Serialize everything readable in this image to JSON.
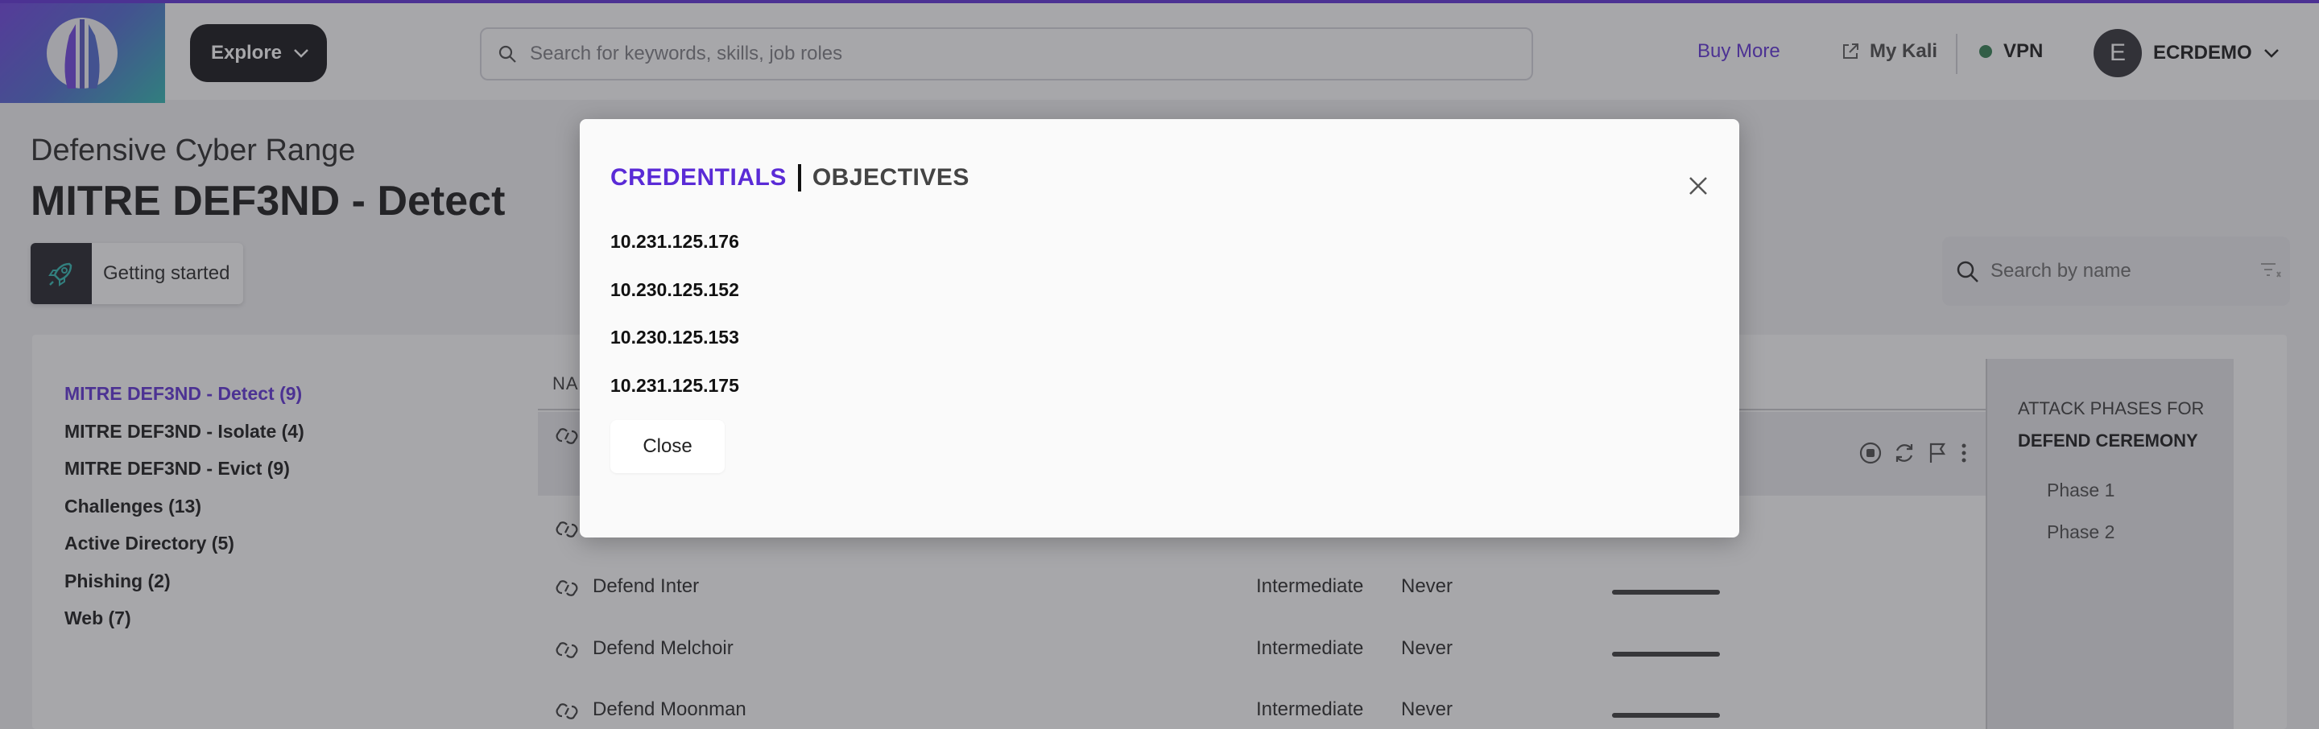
{
  "topbar": {
    "explore_label": "Explore",
    "search_placeholder": "Search for keywords, skills, job roles",
    "buy_more": "Buy More",
    "my_kali": "My Kali",
    "vpn": "VPN",
    "vpn_status_color": "#2b7a4b",
    "avatar_initial": "E",
    "username": "ECRDEMO"
  },
  "header": {
    "category": "Defensive Cyber Range",
    "title": "MITRE DEF3ND - Detect",
    "getting_started": "Getting started",
    "name_search_placeholder": "Search by name"
  },
  "sidebar": {
    "items": [
      {
        "label": "MITRE DEF3ND - Detect (9)",
        "active": true
      },
      {
        "label": "MITRE DEF3ND - Isolate (4)",
        "active": false
      },
      {
        "label": "MITRE DEF3ND - Evict (9)",
        "active": false
      },
      {
        "label": "Challenges (13)",
        "active": false
      },
      {
        "label": "Active Directory (5)",
        "active": false
      },
      {
        "label": "Phishing (2)",
        "active": false
      },
      {
        "label": "Web (7)",
        "active": false
      }
    ]
  },
  "table": {
    "header_name": "NA",
    "rows": [
      {
        "name": "Defend Inter",
        "level": "Intermediate",
        "last": "Never",
        "progress": 0
      },
      {
        "name": "Defend Melchoir",
        "level": "Intermediate",
        "last": "Never",
        "progress": 0
      },
      {
        "name": "Defend Moonman",
        "level": "Intermediate",
        "last": "Never",
        "progress": 0
      }
    ]
  },
  "phases": {
    "title_prefix": "ATTACK PHASES FOR",
    "title_target": "DEFEND CEREMONY",
    "items": [
      "Phase 1",
      "Phase 2"
    ]
  },
  "modal": {
    "tab_credentials": "CREDENTIALS",
    "tab_objectives": "OBJECTIVES",
    "credentials": [
      "10.231.125.176",
      "10.230.125.152",
      "10.230.125.153",
      "10.231.125.175"
    ],
    "close_label": "Close"
  },
  "colors": {
    "accent": "#5a2bd6"
  }
}
